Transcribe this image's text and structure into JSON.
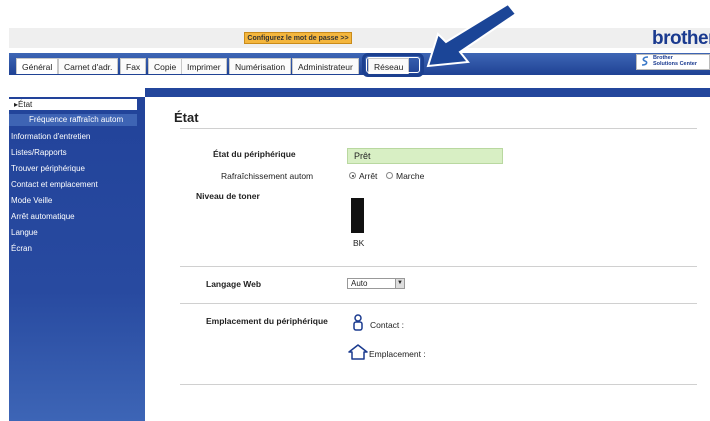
{
  "header": {
    "password_button": "Configurez le mot de passe >>",
    "brand": "brother",
    "solutions_line1": "Brother",
    "solutions_line2": "Solutions Center"
  },
  "tabs": [
    {
      "label": "Général",
      "active": true
    },
    {
      "label": "Carnet d'adr."
    },
    {
      "label": "Fax"
    },
    {
      "label": "Copie"
    },
    {
      "label": "Imprimer"
    },
    {
      "label": "Numérisation"
    },
    {
      "label": "Administrateur"
    },
    {
      "label": "Réseau",
      "highlighted": true
    }
  ],
  "sidebar": {
    "items": [
      {
        "label": "État",
        "selected": true
      },
      {
        "label": "Fréquence raffraîch autom"
      },
      {
        "label": "Information d'entretien"
      },
      {
        "label": "Listes/Rapports"
      },
      {
        "label": "Trouver périphérique"
      },
      {
        "label": "Contact et emplacement"
      },
      {
        "label": "Mode Veille"
      },
      {
        "label": "Arrêt automatique"
      },
      {
        "label": "Langue"
      },
      {
        "label": "Écran"
      }
    ]
  },
  "content": {
    "title": "État",
    "device_status_label": "État du périphérique",
    "device_status_value": "Prêt",
    "refresh_label": "Rafraîchissement autom",
    "refresh_off": "Arrêt",
    "refresh_on": "Marche",
    "refresh_selected": "Arrêt",
    "toner_label": "Niveau de toner",
    "toner_color_label": "BK",
    "toner_level": 1.0,
    "web_language_label": "Langage Web",
    "web_language_value": "Auto",
    "location_label": "Emplacement du périphérique",
    "contact_label": "Contact :",
    "location_value_label": "Emplacement :"
  },
  "colors": {
    "accent": "#1f4294",
    "password_button": "#f4b63d",
    "status_box": "#d8efc4",
    "brand": "#1a3a8f"
  },
  "icons": [
    "arrow-icon",
    "person-icon",
    "house-icon",
    "brother-solutions-logo-icon",
    "dropdown-arrow-icon"
  ]
}
